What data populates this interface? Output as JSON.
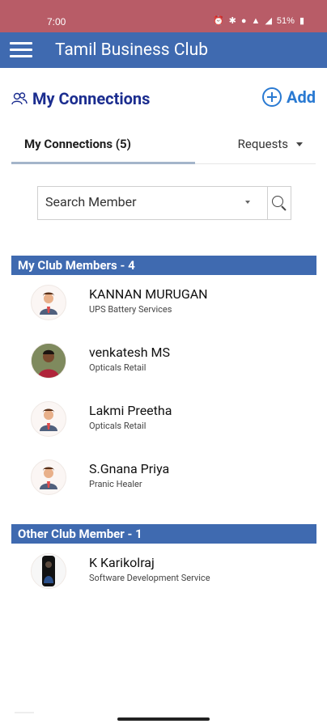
{
  "status_bar": {
    "time": "7:00",
    "battery": "51%",
    "icons": [
      "alarm-icon",
      "bluetooth-icon",
      "location-icon",
      "data-icon",
      "wifi-icon",
      "signal-icon",
      "battery-icon"
    ],
    "color": "#b85c67"
  },
  "app_bar": {
    "title": "Tamil Business Club",
    "color": "#3f6ab0"
  },
  "page": {
    "section_title": "My Connections",
    "add_label": "Add"
  },
  "tabs": {
    "connections": "My Connections (5)",
    "requests": "Requests"
  },
  "search": {
    "placeholder": "Search Member"
  },
  "groups": [
    {
      "header": "My Club Members - 4",
      "members": [
        {
          "name": "KANNAN MURUGAN",
          "subtitle": "UPS Battery Services",
          "avatar": "default-avatar"
        },
        {
          "name": "venkatesh MS",
          "subtitle": "Opticals Retail",
          "avatar": "photo-avatar"
        },
        {
          "name": "Lakmi Preetha",
          "subtitle": "Opticals Retail",
          "avatar": "default-avatar"
        },
        {
          "name": "S.Gnana Priya",
          "subtitle": "Pranic Healer",
          "avatar": "default-avatar"
        }
      ]
    },
    {
      "header": "Other Club Member - 1",
      "members": [
        {
          "name": "K Karikolraj",
          "subtitle": "Software Development Service",
          "avatar": "photo-avatar"
        }
      ]
    }
  ],
  "colors": {
    "accent": "#3f6ab0",
    "title_navy": "#1b2d8f",
    "link_blue": "#2a7ad2"
  }
}
